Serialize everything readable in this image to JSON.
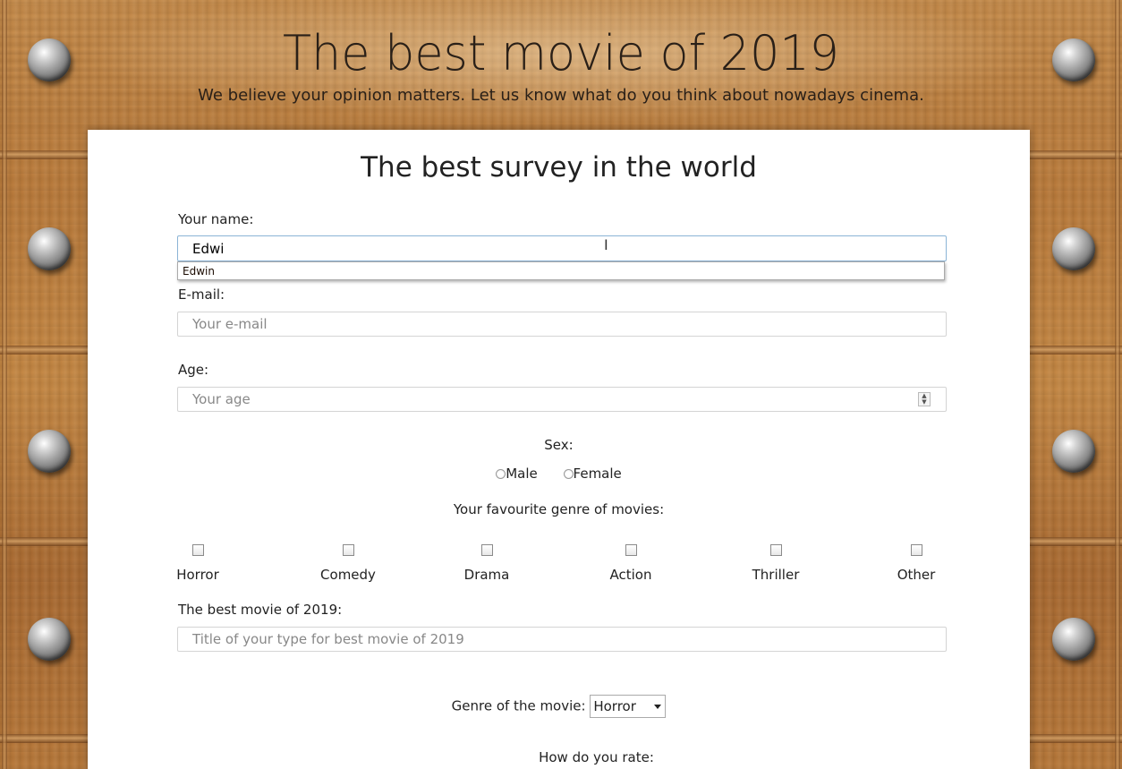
{
  "header": {
    "title": "The best movie of 2019",
    "subtitle": "We believe your opinion matters. Let us know what do you think about nowadays cinema."
  },
  "survey": {
    "title": "The best survey in the world",
    "name_label": "Your name:",
    "name_value": "Edwi",
    "autocomplete_suggestion": "Edwin",
    "email_label": "E-mail:",
    "email_placeholder": "Your e-mail",
    "age_label": "Age:",
    "age_placeholder": "Your age",
    "sex_label": "Sex:",
    "sex_options": [
      "Male",
      "Female"
    ],
    "genre_label": "Your favourite genre of movies:",
    "genres": [
      "Horror",
      "Comedy",
      "Drama",
      "Action",
      "Thriller",
      "Other"
    ],
    "best_movie_label": "The best movie of 2019:",
    "best_movie_placeholder": "Title of your type for best movie of 2019",
    "movie_genre_label": "Genre of the movie:",
    "movie_genre_selected": "Horror",
    "rate_label": "How do you rate:"
  },
  "icons": [
    "rivet",
    "text-cursor-icon",
    "spinner-arrows-icon",
    "dropdown-arrow-icon"
  ]
}
